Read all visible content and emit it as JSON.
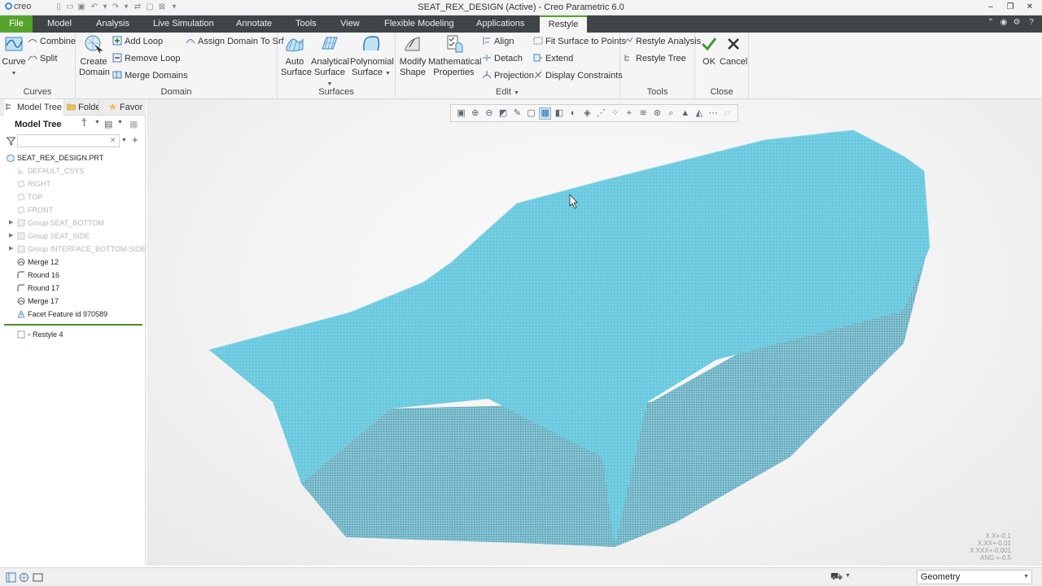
{
  "app": {
    "logo": "creo",
    "window_title": "SEAT_REX_DESIGN (Active) - Creo Parametric 6.0"
  },
  "menu_tabs": [
    {
      "label": "File"
    },
    {
      "label": "Model"
    },
    {
      "label": "Analysis"
    },
    {
      "label": "Live Simulation"
    },
    {
      "label": "Annotate"
    },
    {
      "label": "Tools"
    },
    {
      "label": "View"
    },
    {
      "label": "Flexible Modeling"
    },
    {
      "label": "Applications"
    },
    {
      "label": "Restyle"
    }
  ],
  "active_tab": "Restyle",
  "ribbon": {
    "curves": {
      "group_label": "Curves",
      "curve_label": "Curve",
      "combine_label": "Combine",
      "split_label": "Split"
    },
    "domain": {
      "group_label": "Domain",
      "create_domain_line1": "Create",
      "create_domain_line2": "Domain",
      "add_loop": "Add Loop",
      "remove_loop": "Remove Loop",
      "merge_domains": "Merge Domains",
      "assign_domain": "Assign Domain To Srf"
    },
    "surfaces": {
      "group_label": "Surfaces",
      "auto_line1": "Auto",
      "auto_line2": "Surface",
      "analytical_line1": "Analytical",
      "analytical_line2": "Surface",
      "polynomial_line1": "Polynomial",
      "polynomial_line2": "Surface"
    },
    "edit": {
      "group_label": "Edit",
      "modify_line1": "Modify",
      "modify_line2": "Shape",
      "math_line1": "Mathematical",
      "math_line2": "Properties",
      "align": "Align",
      "detach": "Detach",
      "projection": "Projection",
      "fit_surface": "Fit Surface to Points",
      "extend": "Extend",
      "display_constraints": "Display Constraints"
    },
    "tools": {
      "group_label": "Tools",
      "restyle_analysis": "Restyle Analysis",
      "restyle_tree": "Restyle Tree"
    },
    "close": {
      "group_label": "Close",
      "ok": "OK",
      "cancel": "Cancel"
    }
  },
  "left_panel": {
    "tabs": [
      "Model Tree",
      "Folde",
      "Favor"
    ],
    "header": "Model Tree",
    "search": {
      "value": "",
      "placeholder": ""
    },
    "items": [
      {
        "label": "SEAT_REX_DESIGN.PRT",
        "state": "normal"
      },
      {
        "label": "DEFAULT_CSYS",
        "state": "dim"
      },
      {
        "label": "RIGHT",
        "state": "dim"
      },
      {
        "label": "TOP",
        "state": "dim"
      },
      {
        "label": "FRONT",
        "state": "dim"
      },
      {
        "label": "Group SEAT_BOTTOM",
        "state": "dim"
      },
      {
        "label": "Group SEAT_SIDE",
        "state": "dim"
      },
      {
        "label": "Group INTERFACE_BOTTOM-SIDE",
        "state": "dim"
      },
      {
        "label": "Merge 12",
        "state": "normal"
      },
      {
        "label": "Round 16",
        "state": "normal"
      },
      {
        "label": "Round 17",
        "state": "normal"
      },
      {
        "label": "Merge 17",
        "state": "normal"
      },
      {
        "label": "Facet Feature id 970589",
        "state": "normal"
      }
    ],
    "restyle_item": "Restyle 4"
  },
  "graphics": {
    "model_color": "#6ecbe0",
    "tolerances": [
      "X.X+-0.1",
      "X.XX+-0.01",
      "X.XXX+-0.001",
      "ANG +-0.5"
    ]
  },
  "status_bar": {
    "selection_filter": "Geometry"
  },
  "colors": {
    "file_tab": "#56a42c",
    "tab_bar": "#3f4447",
    "ribbon_bg": "#f5f5f5",
    "accent_ok": "#3e9a2a"
  }
}
